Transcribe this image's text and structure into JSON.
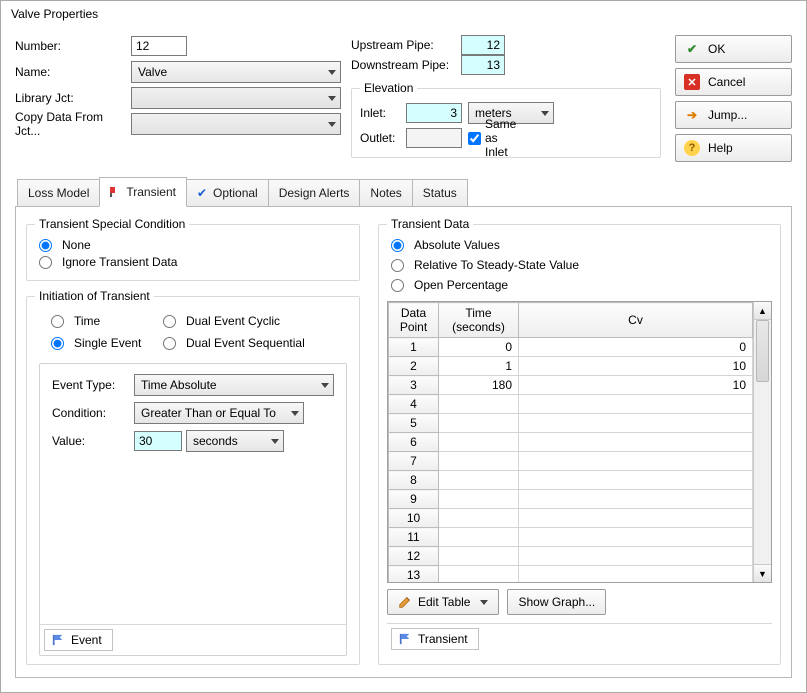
{
  "title": "Valve Properties",
  "form": {
    "number_label": "Number:",
    "number_value": "12",
    "name_label": "Name:",
    "name_value": "Valve",
    "library_label": "Library Jct:",
    "library_value": "",
    "copy_label": "Copy Data From Jct...",
    "copy_value": ""
  },
  "pipes": {
    "upstream_label": "Upstream Pipe:",
    "upstream_value": "12",
    "downstream_label": "Downstream Pipe:",
    "downstream_value": "13"
  },
  "elevation": {
    "legend": "Elevation",
    "inlet_label": "Inlet:",
    "inlet_value": "3",
    "inlet_units": "meters",
    "outlet_label": "Outlet:",
    "outlet_value": "",
    "same_label": "Same as Inlet",
    "same_checked": true
  },
  "buttons": {
    "ok": "OK",
    "cancel": "Cancel",
    "jump": "Jump...",
    "help": "Help"
  },
  "tabs": {
    "loss": "Loss Model",
    "transient": "Transient",
    "optional": "Optional",
    "design": "Design Alerts",
    "notes": "Notes",
    "status": "Status"
  },
  "transient_special": {
    "legend": "Transient Special Condition",
    "none": "None",
    "ignore": "Ignore Transient Data"
  },
  "initiation": {
    "legend": "Initiation of Transient",
    "time": "Time",
    "single": "Single Event",
    "dual_cyclic": "Dual Event Cyclic",
    "dual_seq": "Dual Event Sequential",
    "event_type_label": "Event Type:",
    "event_type_value": "Time Absolute",
    "condition_label": "Condition:",
    "condition_value": "Greater Than or Equal To",
    "value_label": "Value:",
    "value_value": "30",
    "value_units": "seconds",
    "subtab": "Event"
  },
  "transient_data": {
    "legend": "Transient Data",
    "absolute": "Absolute Values",
    "relative": "Relative To Steady-State Value",
    "open_pct": "Open Percentage",
    "col_point": "Data\nPoint",
    "col_time": "Time\n(seconds)",
    "col_cv": "Cv",
    "rows": [
      {
        "n": "1",
        "t": "0",
        "cv": "0"
      },
      {
        "n": "2",
        "t": "1",
        "cv": "10"
      },
      {
        "n": "3",
        "t": "180",
        "cv": "10"
      },
      {
        "n": "4",
        "t": "",
        "cv": ""
      },
      {
        "n": "5",
        "t": "",
        "cv": ""
      },
      {
        "n": "6",
        "t": "",
        "cv": ""
      },
      {
        "n": "7",
        "t": "",
        "cv": ""
      },
      {
        "n": "8",
        "t": "",
        "cv": ""
      },
      {
        "n": "9",
        "t": "",
        "cv": ""
      },
      {
        "n": "10",
        "t": "",
        "cv": ""
      },
      {
        "n": "11",
        "t": "",
        "cv": ""
      },
      {
        "n": "12",
        "t": "",
        "cv": ""
      },
      {
        "n": "13",
        "t": "",
        "cv": ""
      }
    ],
    "edit_table": "Edit Table",
    "show_graph": "Show Graph...",
    "subtab": "Transient"
  }
}
